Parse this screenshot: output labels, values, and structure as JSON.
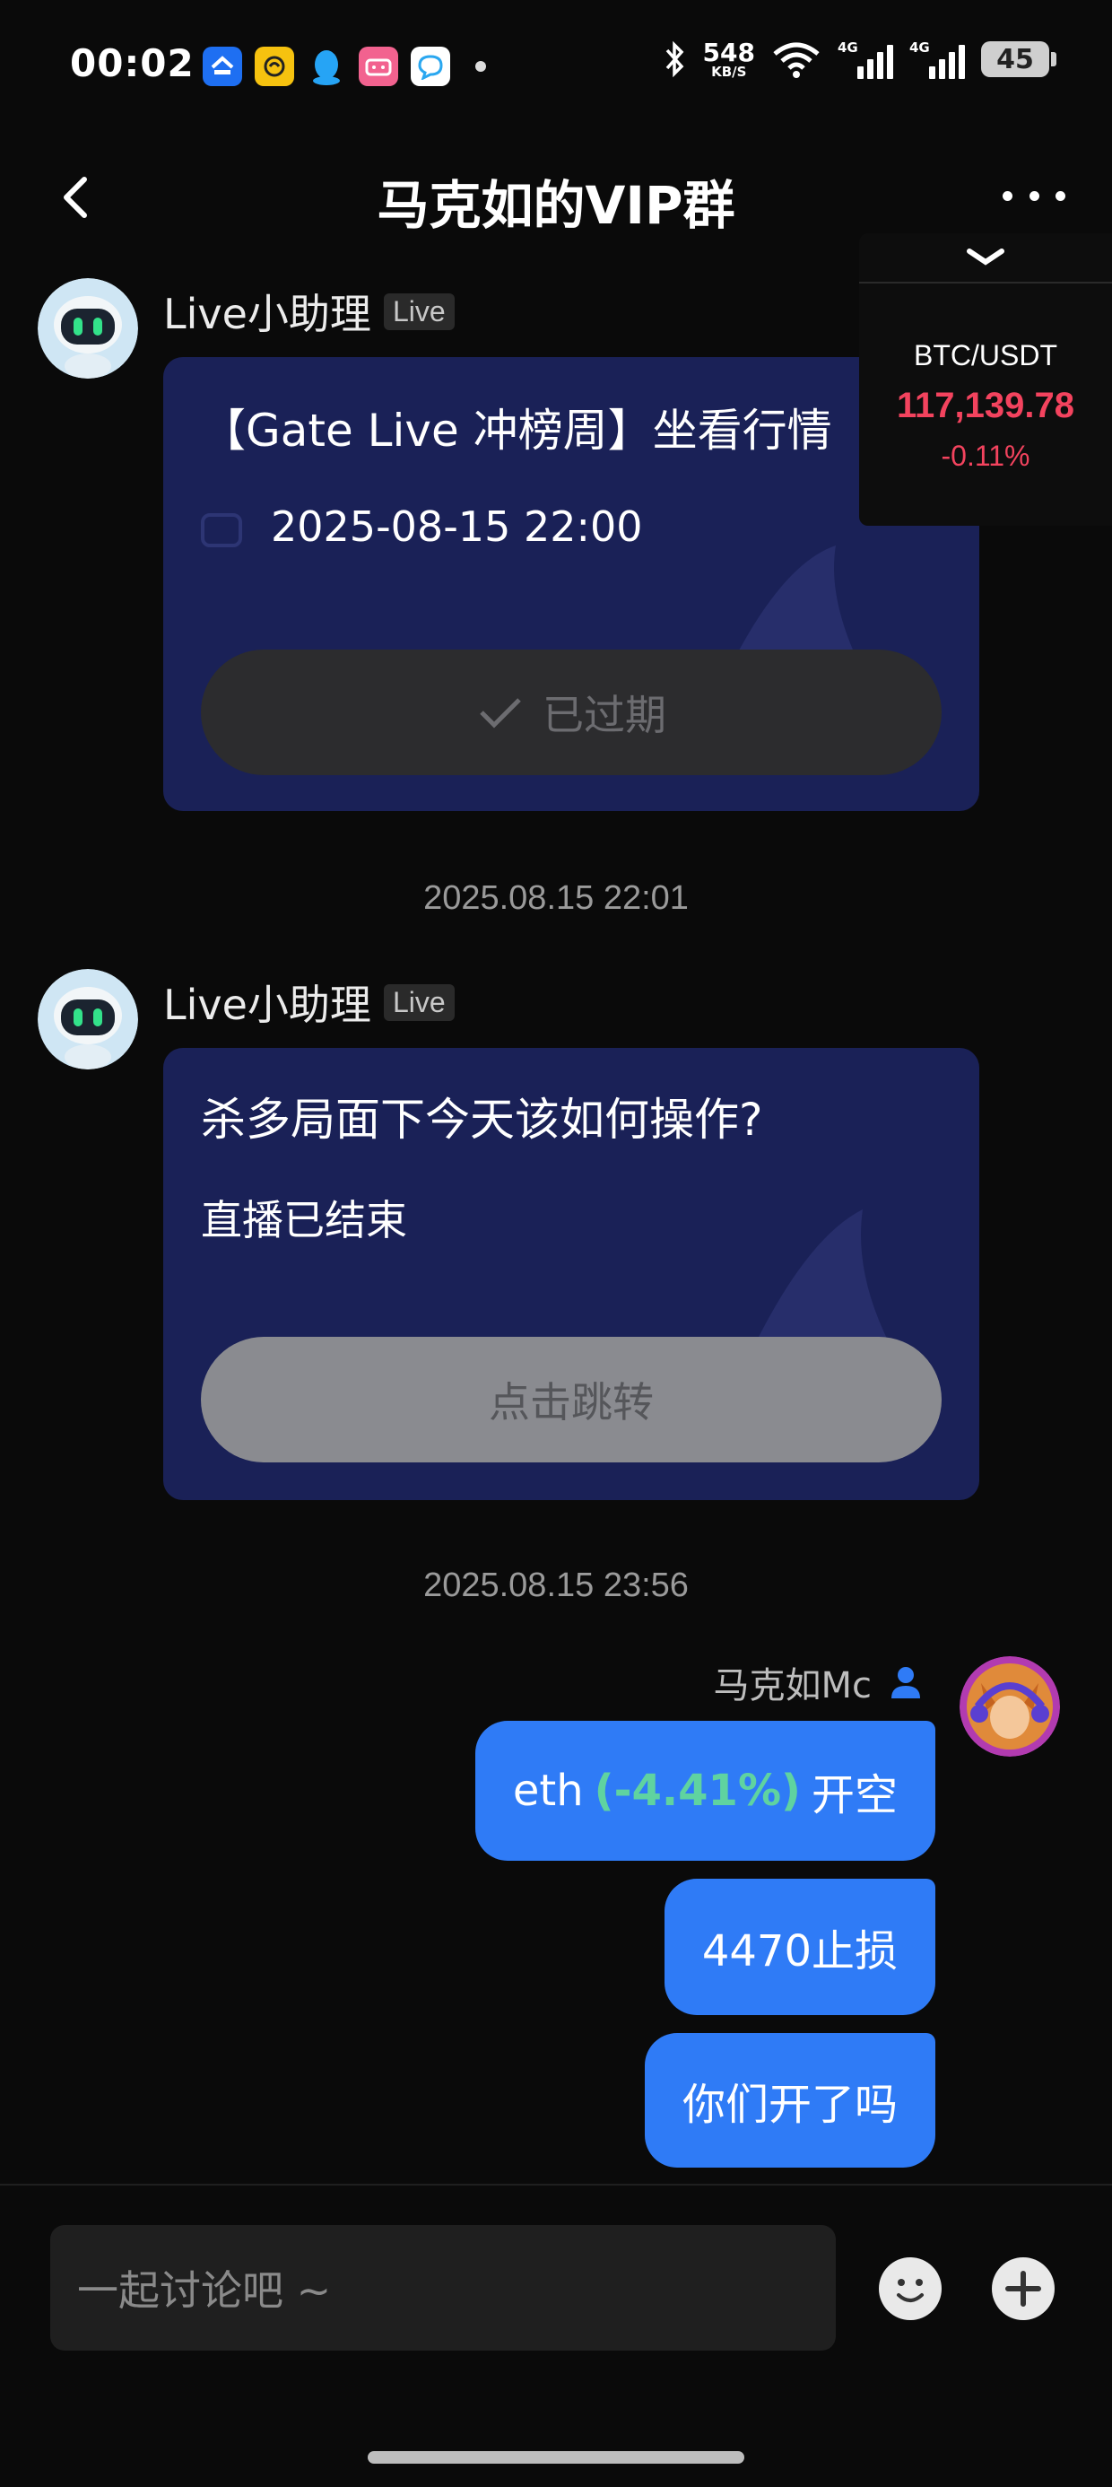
{
  "status_bar": {
    "time": "00:02",
    "net_speed_value": "548",
    "net_speed_unit": "KB/S",
    "signal_1_label": "4G",
    "signal_2_label": "4G",
    "battery": "45",
    "app_icons": [
      "app-icon-1",
      "app-icon-2",
      "qq-icon",
      "bilibili-icon",
      "message-icon"
    ]
  },
  "header": {
    "title": "马克如的VIP群"
  },
  "ticker": {
    "pair": "BTC/USDT",
    "price": "117,139.78",
    "change": "-0.11%"
  },
  "messages": [
    {
      "sender": "Live小助理",
      "tag": "Live",
      "card_title": "【Gate Live 冲榜周】坐看行情",
      "card_datetime": "2025-08-15 22:00",
      "button_label": "已过期"
    },
    {
      "timestamp": "2025.08.15 22:01"
    },
    {
      "sender": "Live小助理",
      "tag": "Live",
      "card_title": "杀多局面下今天该如何操作?",
      "card_sub": "直播已结束",
      "button_label": "点击跳转"
    },
    {
      "timestamp": "2025.08.15 23:56"
    },
    {
      "sender": "马克如Mc",
      "bubble_1_prefix": "eth",
      "bubble_1_pct": "(-4.41%)",
      "bubble_1_suffix": "开空",
      "bubble_2": "4470止损",
      "bubble_3": "你们开了吗"
    }
  ],
  "input": {
    "placeholder": "一起讨论吧 ~"
  },
  "colors": {
    "accent_blue": "#2f7bf6",
    "card_navy": "#1a2157",
    "price_red": "#f3435e",
    "pct_green": "#5fd3a0"
  }
}
